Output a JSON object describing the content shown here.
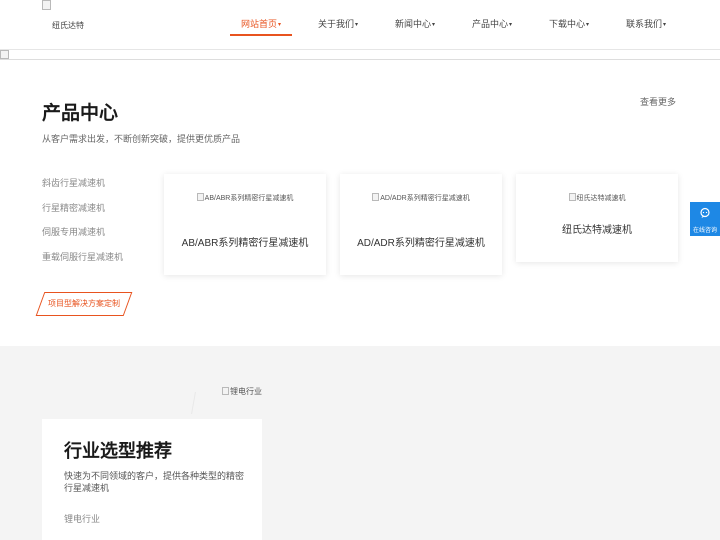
{
  "header": {
    "logo_text": "纽氏达特",
    "nav": [
      {
        "label": "网站首页",
        "active": true
      },
      {
        "label": "关于我们",
        "active": false
      },
      {
        "label": "新闻中心",
        "active": false
      },
      {
        "label": "产品中心",
        "active": false
      },
      {
        "label": "下载中心",
        "active": false
      },
      {
        "label": "联系我们",
        "active": false
      }
    ],
    "caret": "▾"
  },
  "products": {
    "title": "产品中心",
    "subtitle": "从客户需求出发，不断创新突破，提供更优质产品",
    "more_label": "查看更多",
    "categories": [
      "斜齿行星减速机",
      "行星精密减速机",
      "伺服专用减速机",
      "重载伺服行星减速机"
    ],
    "solution_label": "项目型解决方案定制",
    "cards": [
      {
        "img_alt": "AB/ABR系列精密行星减速机",
        "name": "AB/ABR系列精密行星减速机"
      },
      {
        "img_alt": "AD/ADR系列精密行星减速机",
        "name": "AD/ADR系列精密行星减速机"
      },
      {
        "img_alt": "纽氏达特减速机",
        "name": "纽氏达特减速机"
      }
    ]
  },
  "float_button": {
    "label": "在线咨询",
    "icon": "chat-icon"
  },
  "industry": {
    "img_alt": "锂电行业",
    "title": "行业选型推荐",
    "description": "快速为不同领域的客户，提供各种类型的精密行星减速机",
    "item": "锂电行业"
  },
  "colors": {
    "accent": "#e8531f",
    "float": "#1e88e5",
    "section_bg": "#f4f4f4"
  }
}
